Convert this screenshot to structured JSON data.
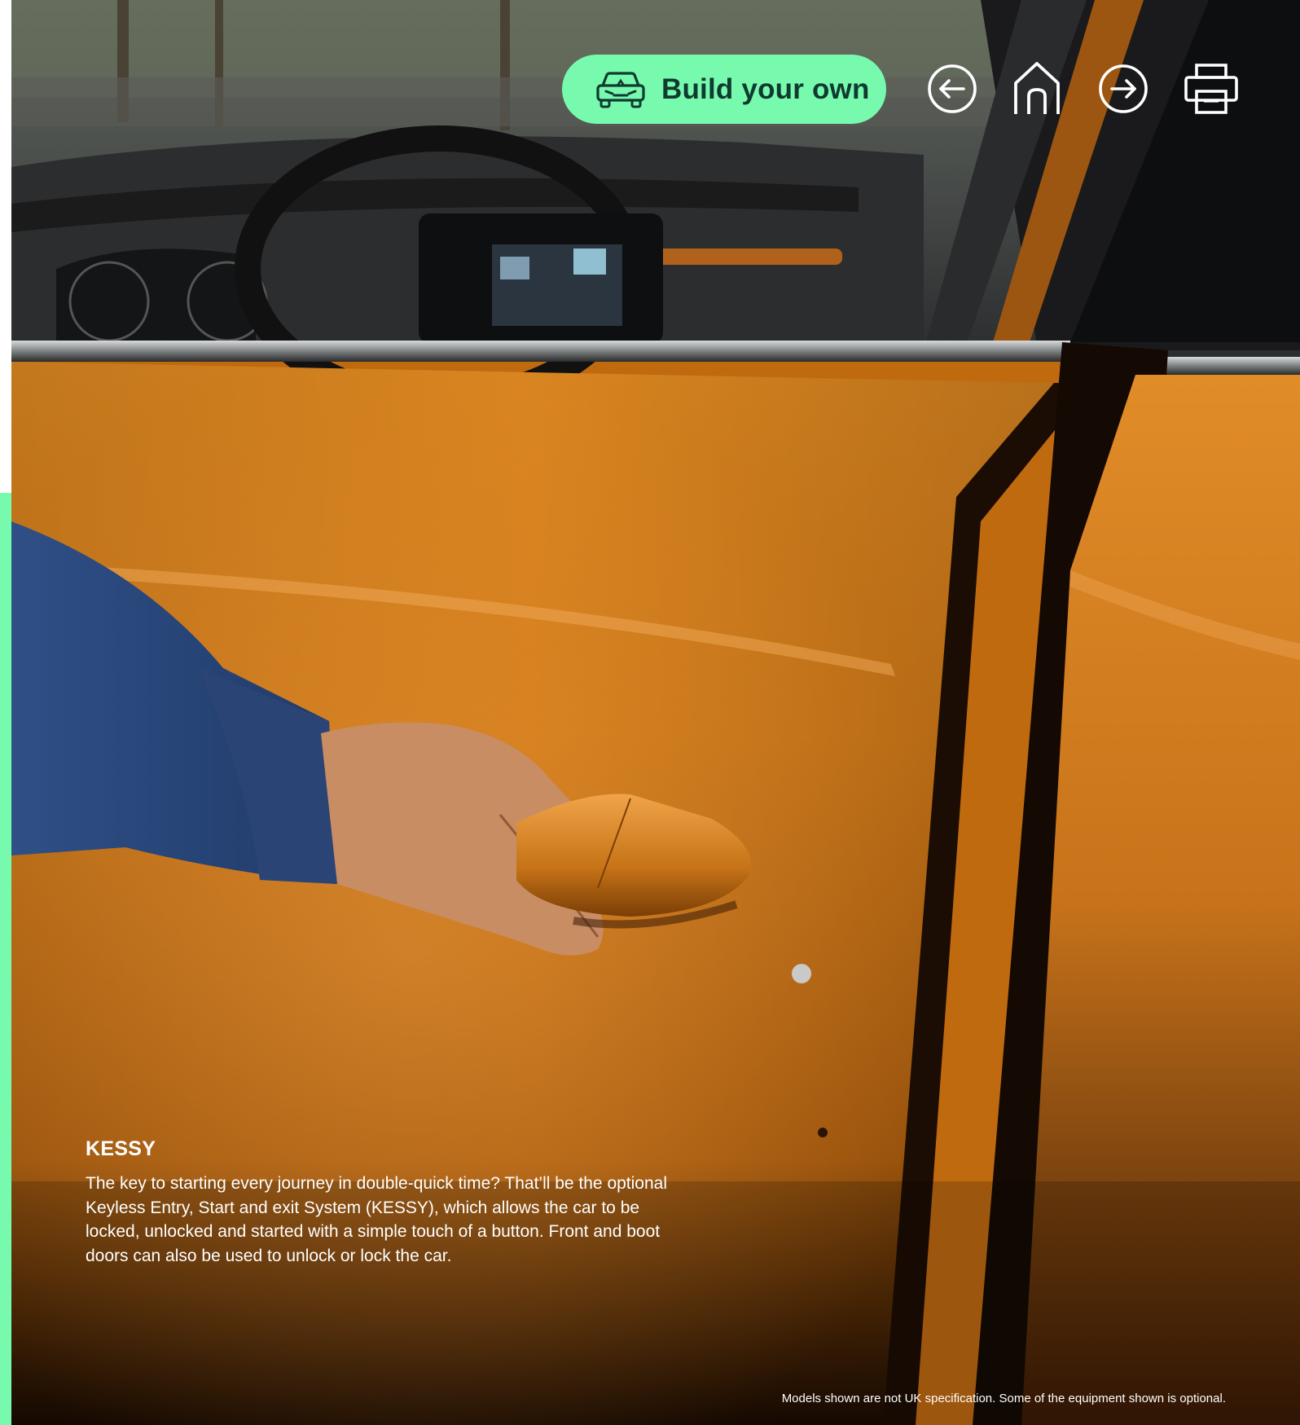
{
  "toolbar": {
    "build_label": "Build your own",
    "build_icon": "car-front-icon",
    "icons": [
      "arrow-left-circle-icon",
      "home-icon",
      "arrow-right-circle-icon",
      "printer-icon"
    ],
    "accent_color": "#78faae",
    "accent_text_color": "#0e3a2f"
  },
  "feature": {
    "heading": "KESSY",
    "body": "The key to starting every journey in double-quick time? That’ll be the optional Keyless Entry, Start and exit System (KESSY), which allows the car to be locked, unlocked and started with a simple touch of a button. Front and boot doors can also be used to unlock or lock the car."
  },
  "footer": {
    "disclaimer": "Models shown are not UK specification. Some of the equipment shown is optional."
  },
  "photo": {
    "subject": "hand-on-door-handle",
    "car_color": "#c06a10"
  }
}
